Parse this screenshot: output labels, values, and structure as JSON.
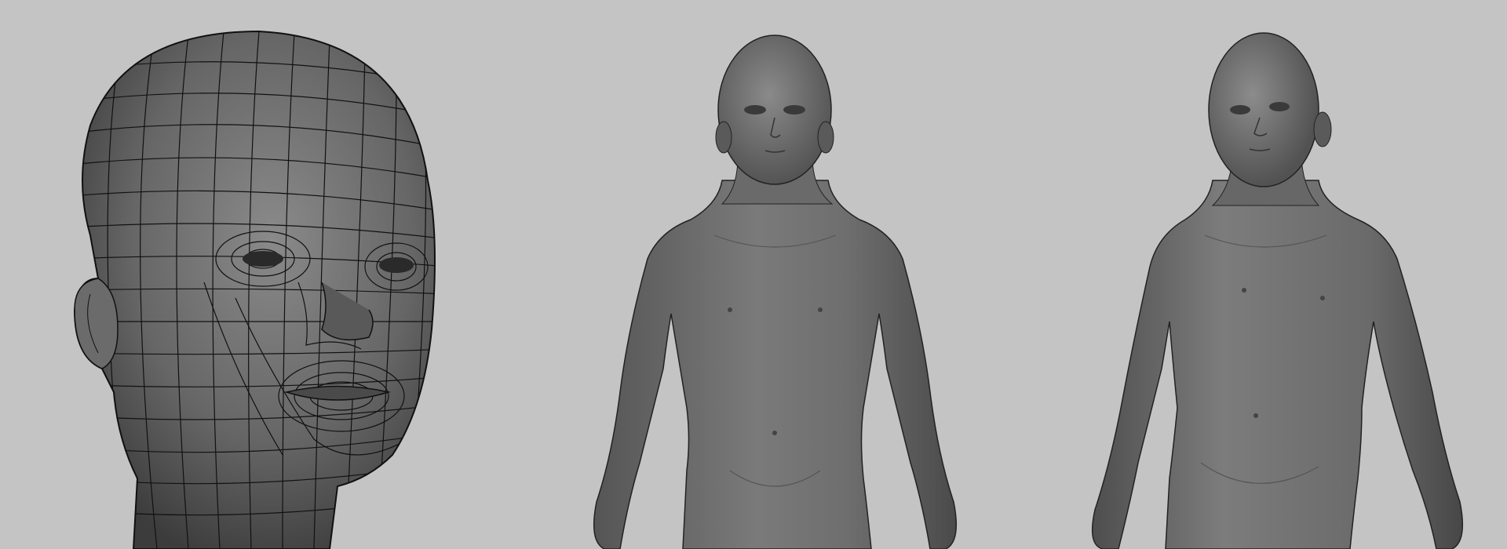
{
  "viewport": {
    "background": "#c4c4c4",
    "panels": [
      {
        "id": "head-wireframe-view",
        "content": "wireframe-head-model"
      },
      {
        "id": "body-front-view",
        "content": "shaded-body-front"
      },
      {
        "id": "body-three-quarter-view",
        "content": "shaded-body-three-quarter"
      }
    ]
  },
  "colors": {
    "background": "#c4c4c4",
    "model_shade": "#6a6a6a",
    "model_dark": "#3a3a3a",
    "model_light": "#8a8a8a",
    "wire": "#111111"
  }
}
